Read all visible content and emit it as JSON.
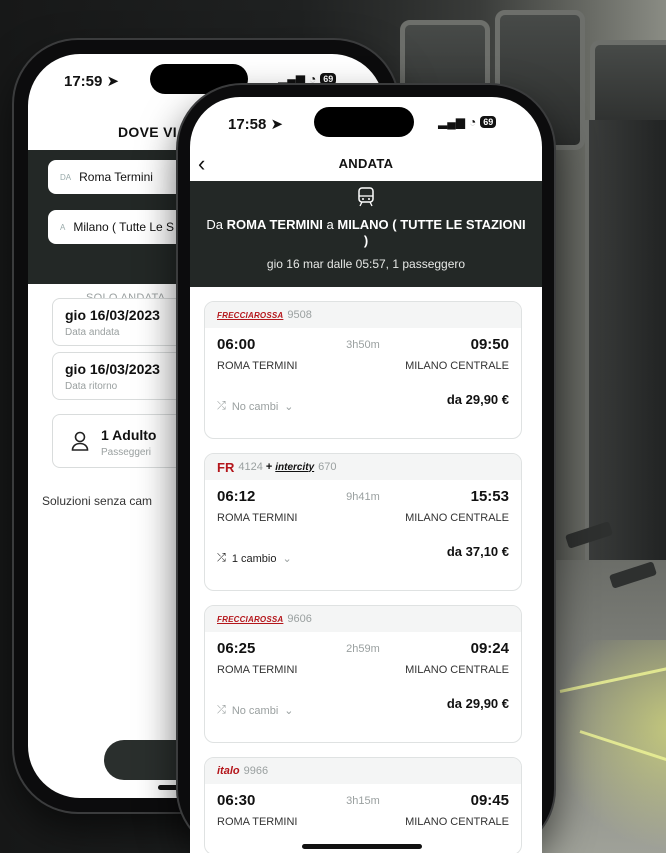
{
  "colors": {
    "panel": "#232826",
    "brand_red": "#b4161b",
    "muted": "#9aa0a0"
  },
  "back_phone": {
    "status": {
      "time": "17:59",
      "battery": "69"
    },
    "header_title": "DOVE VI",
    "from_field": {
      "prefix": "DA",
      "value": "Roma Termini"
    },
    "to_field": {
      "prefix": "A",
      "value": "Milano ( Tutte Le S"
    },
    "trip_type": "SOLO ANDATA",
    "departure_date": {
      "value": "gio 16/03/2023",
      "label": "Data andata"
    },
    "return_date": {
      "value": "gio 16/03/2023",
      "label": "Data ritorno"
    },
    "passengers": {
      "value": "1 Adulto",
      "label": "Passeggeri",
      "icon": "user-icon"
    },
    "direct_only_text": "Soluzioni senza cam"
  },
  "front_phone": {
    "status": {
      "time": "17:58",
      "battery": "69"
    },
    "title": "ANDATA",
    "route": {
      "icon": "train-icon",
      "line1_prefix": "Da",
      "origin": "ROMA TERMINI",
      "connector": "a",
      "destination": "MILANO ( TUTTE LE STAZIONI )",
      "details": "gio 16 mar dalle 05:57, 1 passeggero"
    },
    "results": [
      {
        "brand": "FRECCIAROSSA",
        "train_number": "9508",
        "dep": "06:00",
        "duration": "3h50m",
        "arr": "09:50",
        "from": "ROMA TERMINI",
        "to": "MILANO CENTRALE",
        "changes": "No cambi",
        "price": "da 29,90 €"
      },
      {
        "brand": "FR",
        "train_number": "4124",
        "plus": "+",
        "brand2": "intercity",
        "train_number2": "670",
        "dep": "06:12",
        "duration": "9h41m",
        "arr": "15:53",
        "from": "ROMA TERMINI",
        "to": "MILANO CENTRALE",
        "changes": "1 cambio",
        "price": "da 37,10 €"
      },
      {
        "brand": "FRECCIAROSSA",
        "train_number": "9606",
        "dep": "06:25",
        "duration": "2h59m",
        "arr": "09:24",
        "from": "ROMA TERMINI",
        "to": "MILANO CENTRALE",
        "changes": "No cambi",
        "price": "da 29,90 €"
      },
      {
        "brand": "italo",
        "train_number": "9966",
        "dep": "06:30",
        "duration": "3h15m",
        "arr": "09:45",
        "from": "ROMA TERMINI",
        "to": "MILANO CENTRALE"
      }
    ]
  }
}
